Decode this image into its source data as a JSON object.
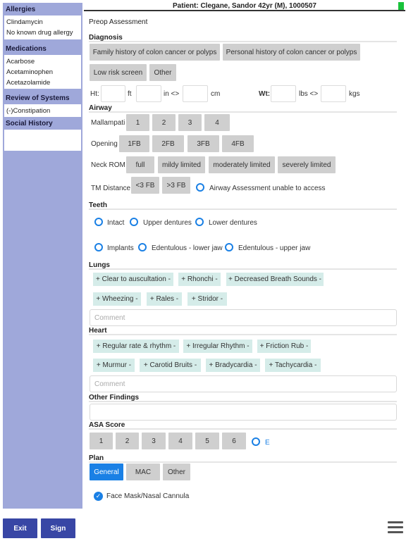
{
  "header": {
    "patient": "Patient: Clegane, Sandor 42yr (M), 1000507"
  },
  "sidebar": {
    "allergies": {
      "title": "Allergies",
      "items": [
        "Clindamycin",
        "No known drug allergy"
      ]
    },
    "medications": {
      "title": "Medications",
      "items": [
        "Acarbose",
        "Acetaminophen",
        "Acetazolamide"
      ]
    },
    "ros": {
      "title": "Review of Systems",
      "items": [
        "(-)Constipation"
      ]
    },
    "social": {
      "title": "Social History",
      "items": []
    }
  },
  "main": {
    "title": "Preop Assessment",
    "diagnosis": {
      "title": "Diagnosis",
      "options": [
        "Family history of colon cancer or polyps",
        "Personal history of colon cancer or polyps",
        "Low risk screen",
        "Other"
      ]
    },
    "measurements": {
      "ht_label": "Ht:",
      "ft_unit": "ft",
      "in_unit": "in <>",
      "cm_unit": "cm",
      "wt_label": "Wt:",
      "lbs_unit": "lbs <>",
      "kgs_unit": "kgs"
    },
    "airway": {
      "title": "Airway",
      "mallampati_label": "Mallampati",
      "mallampati": [
        "1",
        "2",
        "3",
        "4"
      ],
      "opening_label": "Opening",
      "opening": [
        "1FB",
        "2FB",
        "3FB",
        "4FB"
      ],
      "neck_label": "Neck ROM",
      "neck": [
        "full",
        "mildy limited",
        "moderately limited",
        "severely limited"
      ],
      "tm_label": "TM Distance",
      "tm": [
        "<3 FB",
        ">3 FB"
      ],
      "unable_label": "Airway Assessment unable to access"
    },
    "teeth": {
      "title": "Teeth",
      "options": [
        "Intact",
        "Upper dentures",
        "Lower dentures",
        "Implants",
        "Edentulous - lower jaw",
        "Edentulous - upper jaw"
      ]
    },
    "lungs": {
      "title": "Lungs",
      "tags": [
        "+ Clear to auscultation -",
        "+ Rhonchi -",
        "+ Decreased Breath Sounds -",
        "+ Wheezing -",
        "+ Rales -",
        "+ Stridor -"
      ],
      "comment_placeholder": "Comment"
    },
    "heart": {
      "title": "Heart",
      "tags": [
        "+ Regular rate & rhythm -",
        "+ Irregular Rhythm -",
        "+ Friction Rub -",
        "+ Murmur -",
        "+ Carotid Bruits -",
        "+ Bradycardia -",
        "+ Tachycardia -"
      ],
      "comment_placeholder": "Comment"
    },
    "other_findings": {
      "title": "Other Findings"
    },
    "asa": {
      "title": "ASA Score",
      "options": [
        "1",
        "2",
        "3",
        "4",
        "5",
        "6"
      ],
      "e_label": "E"
    },
    "plan": {
      "title": "Plan",
      "options": [
        "General",
        "MAC",
        "Other"
      ],
      "selected": "General",
      "face_mask_label": "Face Mask/Nasal Cannula",
      "face_mask_checked": true
    }
  },
  "footer": {
    "exit_label": "Exit",
    "sign_label": "Sign"
  },
  "colors": {
    "accent": "#1a80e5",
    "sidebar": "#9fa8da",
    "footer_button": "#3846a5",
    "status": "#19c23b"
  }
}
